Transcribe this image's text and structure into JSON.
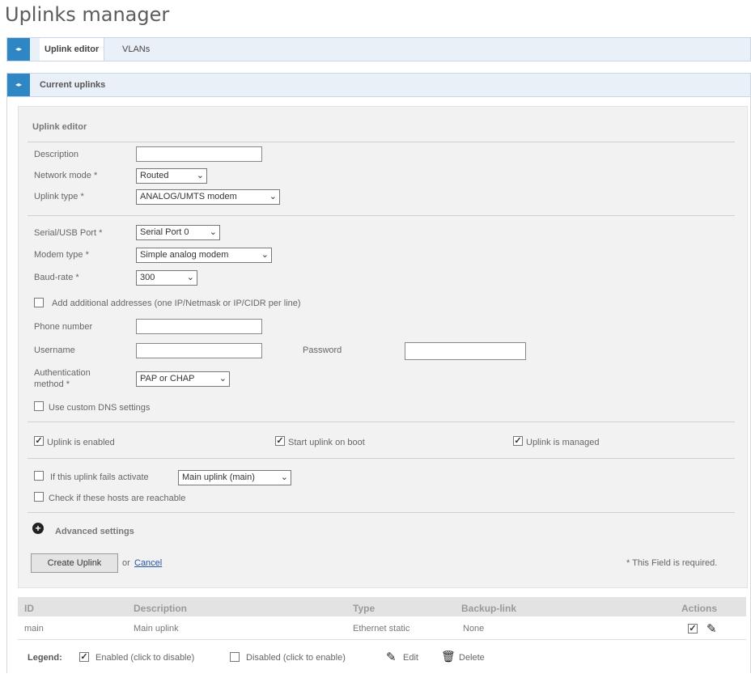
{
  "page": {
    "title": "Uplinks manager"
  },
  "tabs_bar": {
    "toggle": "◂▸",
    "tabs": [
      "Uplink editor",
      "VLANs"
    ]
  },
  "current_bar": {
    "toggle": "◂▸",
    "title": "Current uplinks"
  },
  "editor": {
    "title": "Uplink editor",
    "description_label": "Description",
    "description_value": "",
    "network_mode_label": "Network mode *",
    "network_mode_value": "Routed",
    "uplink_type_label": "Uplink type *",
    "uplink_type_value": "ANALOG/UMTS modem",
    "serial_port_label": "Serial/USB Port *",
    "serial_port_value": "Serial Port 0",
    "modem_type_label": "Modem type *",
    "modem_type_value": "Simple analog modem",
    "baud_rate_label": "Baud-rate *",
    "baud_rate_value": "300",
    "additional_addresses_label": "Add additional addresses (one IP/Netmask or IP/CIDR per line)",
    "phone_label": "Phone number",
    "username_label": "Username",
    "password_label": "Password",
    "auth_label_line1": "Authentication",
    "auth_label_line2": "method *",
    "auth_value": "PAP or CHAP",
    "custom_dns_label": "Use custom DNS settings",
    "enabled_label": "Uplink is enabled",
    "start_on_boot_label": "Start uplink on boot",
    "managed_label": "Uplink is managed",
    "fails_label": "If this uplink fails activate",
    "fails_value": "Main uplink (main)",
    "check_hosts_label": "Check if these hosts are reachable",
    "advanced_label": "Advanced settings",
    "create_button": "Create Uplink",
    "or_text": "or",
    "cancel_link": "Cancel",
    "required_note": "* This Field is required."
  },
  "table": {
    "columns": [
      "ID",
      "Description",
      "Type",
      "Backup-link",
      "Actions"
    ],
    "rows": [
      {
        "id": "main",
        "description": "Main uplink",
        "type": "Ethernet static",
        "backup_link": "None"
      }
    ]
  },
  "legend": {
    "label": "Legend:",
    "enabled": "Enabled (click to disable)",
    "disabled": "Disabled (click to enable)",
    "edit": "Edit",
    "delete": "Delete"
  },
  "icons": {
    "check": "checkbox-checked-icon",
    "edit": "pencil-icon",
    "delete": "trash-icon",
    "expand": "plus-icon"
  },
  "colors": {
    "accent": "#2f86c4",
    "link": "#2255aa",
    "bar_bg": "#eaf0f8"
  }
}
